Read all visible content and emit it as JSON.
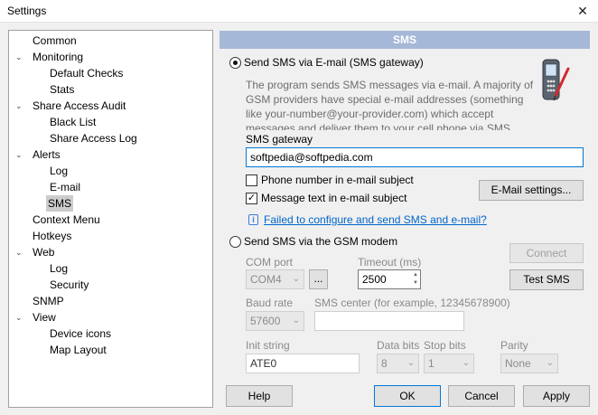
{
  "window": {
    "title": "Settings",
    "close_glyph": "✕"
  },
  "tree": {
    "items": [
      {
        "label": "Common"
      },
      {
        "label": "Monitoring"
      },
      {
        "label": "Default Checks"
      },
      {
        "label": "Stats"
      },
      {
        "label": "Share Access Audit"
      },
      {
        "label": "Black List"
      },
      {
        "label": "Share Access Log"
      },
      {
        "label": "Alerts"
      },
      {
        "label": "Log"
      },
      {
        "label": "E-mail"
      },
      {
        "label": "SMS"
      },
      {
        "label": "Context Menu"
      },
      {
        "label": "Hotkeys"
      },
      {
        "label": "Web"
      },
      {
        "label": "Log"
      },
      {
        "label": "Security"
      },
      {
        "label": "SNMP"
      },
      {
        "label": "View"
      },
      {
        "label": "Device icons"
      },
      {
        "label": "Map Layout"
      }
    ],
    "selected": "SMS",
    "chevron": "⌄"
  },
  "panel": {
    "header": "SMS",
    "email_option": {
      "label": "Send SMS via E-mail (SMS gateway)",
      "selected": true,
      "description_lines": [
        "The program sends SMS messages via e-mail. A majority of",
        "GSM providers have special e-mail addresses (something",
        "like your-number@your-provider.com) which accept",
        "messages and deliver them to your cell phone via SMS"
      ],
      "gateway_label": "SMS gateway",
      "gateway_value": "softpedia@softpedia.com",
      "phone_in_subject_label": "Phone number in e-mail subject",
      "phone_in_subject_checked": false,
      "message_in_subject_label": "Message text in e-mail subject",
      "message_in_subject_checked": true,
      "check_glyph": "✓",
      "email_settings_button": "E-Mail settings...",
      "help_link": "Failed to configure and send SMS and e-mail?",
      "info_glyph": "i"
    },
    "gsm_option": {
      "label": "Send SMS via the GSM modem",
      "selected": false,
      "connect_button": "Connect",
      "test_button": "Test SMS",
      "com_port_label": "COM port",
      "com_port_value": "COM4",
      "browse_button": "...",
      "timeout_label": "Timeout (ms)",
      "timeout_value": "2500",
      "baud_label": "Baud rate",
      "baud_value": "57600",
      "sms_center_label": "SMS center (for example, 12345678900)",
      "sms_center_value": "",
      "init_label": "Init string",
      "init_value": "ATE0",
      "data_bits_label": "Data bits",
      "data_bits_value": "8",
      "stop_bits_label": "Stop bits",
      "stop_bits_value": "1",
      "parity_label": "Parity",
      "parity_value": "None",
      "arrow_glyph": "⌄",
      "spin_up": "▲",
      "spin_down": "▼"
    }
  },
  "footer": {
    "help": "Help",
    "ok": "OK",
    "cancel": "Cancel",
    "apply": "Apply"
  },
  "colors": {
    "header_bg": "#a6b8d7",
    "link": "#0066cc",
    "selection": "#cccccc"
  }
}
